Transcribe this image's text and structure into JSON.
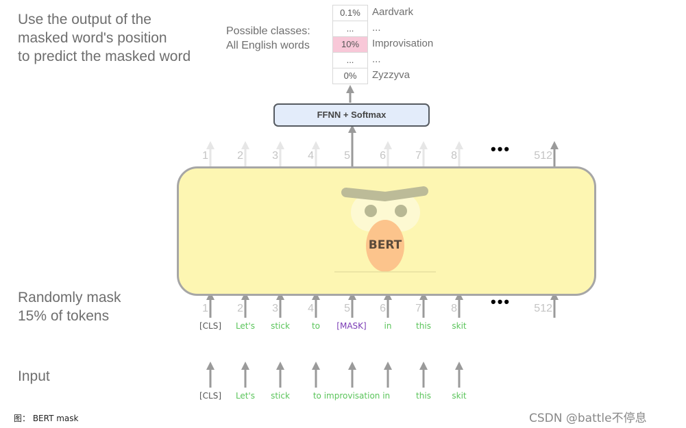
{
  "top_note": {
    "lines": [
      "Use the output of the",
      "masked word's position",
      "to predict the masked word"
    ]
  },
  "classes_note": {
    "lines": [
      "Possible classes:",
      "All English words"
    ]
  },
  "output_table": {
    "rows": [
      {
        "prob": "0.1%",
        "word": "Aardvark",
        "highlight": false
      },
      {
        "prob": "...",
        "word": "...",
        "highlight": false
      },
      {
        "prob": "10%",
        "word": "Improvisation",
        "highlight": true
      },
      {
        "prob": "...",
        "word": "...",
        "highlight": false
      },
      {
        "prob": "0%",
        "word": "Zyzzyva",
        "highlight": false
      }
    ],
    "highlight_color": "#f8c8d8"
  },
  "ffnn": {
    "label": "FFNN + Softmax"
  },
  "bert": {
    "label": "BERT",
    "body_color": "#fdf6b2",
    "nose_color": "#fcc48c"
  },
  "positions": [
    "1",
    "2",
    "3",
    "4",
    "5",
    "6",
    "7",
    "8",
    "512"
  ],
  "ellipsis": "•••",
  "masked_position_index": 4,
  "mask_note": {
    "lines": [
      "Randomly mask",
      "15% of tokens"
    ]
  },
  "masked_tokens": [
    {
      "text": "[CLS]",
      "style": "dark"
    },
    {
      "text": "Let's",
      "style": "green"
    },
    {
      "text": "stick",
      "style": "green"
    },
    {
      "text": "to",
      "style": "green"
    },
    {
      "text": "[MASK]",
      "style": "purple"
    },
    {
      "text": "in",
      "style": "green"
    },
    {
      "text": "this",
      "style": "green"
    },
    {
      "text": "skit",
      "style": "green"
    }
  ],
  "input_note": {
    "label": "Input"
  },
  "input_tokens": [
    {
      "text": "[CLS]",
      "style": "dark"
    },
    {
      "text": "Let's",
      "style": "green"
    },
    {
      "text": "stick",
      "style": "green"
    },
    {
      "text": "to improvisation in",
      "style": "green"
    },
    {
      "text": "this",
      "style": "green"
    },
    {
      "text": "skit",
      "style": "green"
    }
  ],
  "caption": "图： BERT mask",
  "watermark": "CSDN @battle不停息"
}
